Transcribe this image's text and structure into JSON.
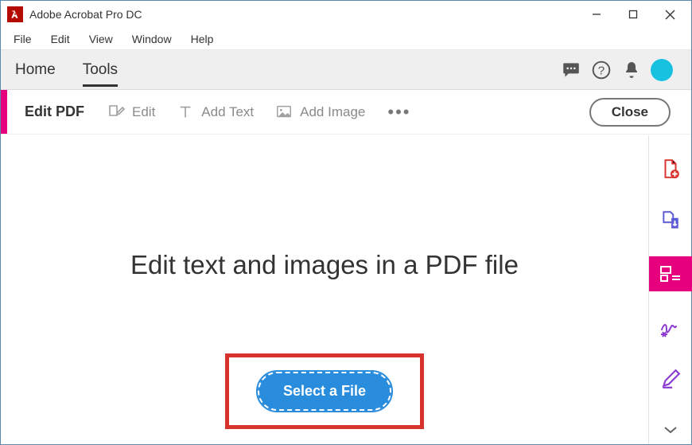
{
  "window": {
    "title": "Adobe Acrobat Pro DC"
  },
  "menubar": {
    "items": [
      "File",
      "Edit",
      "View",
      "Window",
      "Help"
    ]
  },
  "topnav": {
    "home": "Home",
    "tools": "Tools"
  },
  "toolbar": {
    "title": "Edit PDF",
    "edit": "Edit",
    "add_text": "Add Text",
    "add_image": "Add Image",
    "close": "Close"
  },
  "main": {
    "headline": "Edit text and images in a PDF file",
    "select_file": "Select a File"
  }
}
